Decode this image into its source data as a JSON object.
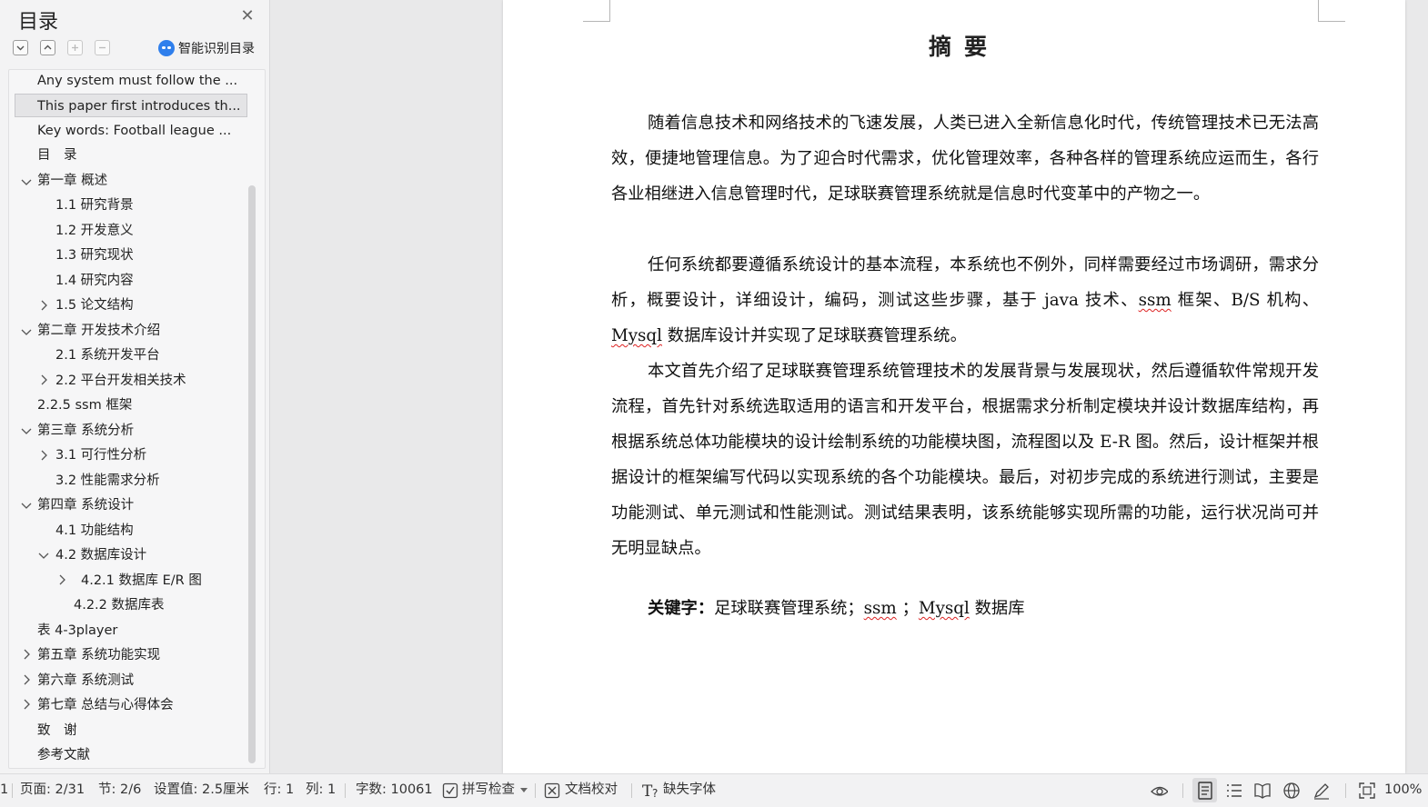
{
  "sidebar": {
    "title": "目录",
    "smart_label": "智能识别目录",
    "toc": [
      {
        "label": "Any system must follow the ..."
      },
      {
        "label": "This paper first introduces th..."
      },
      {
        "label": "Key words: Football league ..."
      },
      {
        "label": "目　录"
      },
      {
        "label": "第一章  概述"
      },
      {
        "label": "1.1  研究背景"
      },
      {
        "label": "1.2 开发意义"
      },
      {
        "label": "1.3  研究现状"
      },
      {
        "label": "1.4  研究内容"
      },
      {
        "label": "1.5 论文结构"
      },
      {
        "label": " 第二章  开发技术介绍"
      },
      {
        "label": "2.1  系统开发平台"
      },
      {
        "label": "2.2  平台开发相关技术"
      },
      {
        "label": "2.2.5    ssm 框架"
      },
      {
        "label": "第三章  系统分析"
      },
      {
        "label": "3.1  可行性分析"
      },
      {
        "label": "3.2 性能需求分析"
      },
      {
        "label": "第四章  系统设计"
      },
      {
        "label": "4.1 功能结构"
      },
      {
        "label": "4.2  数据库设计"
      },
      {
        "label": "4.2.1  数据库 E/R 图"
      },
      {
        "label": "4.2.2  数据库表"
      },
      {
        "label": "表 4-3player"
      },
      {
        "label": "第五章  系统功能实现"
      },
      {
        "label": "第六章  系统测试"
      },
      {
        "label": "第七章  总结与心得体会"
      },
      {
        "label": "致　谢"
      },
      {
        "label": "参考文献"
      }
    ]
  },
  "document": {
    "title": "摘要",
    "paragraphs": [
      "随着信息技术和网络技术的飞速发展，人类已进入全新信息化时代，传统管理技术已无法高效，便捷地管理信息。为了迎合时代需求，优化管理效率，各种各样的管理系统应运而生，各行各业相继进入信息管理时代，足球联赛管理系统就是信息时代变革中的产物之一。",
      "任何系统都要遵循系统设计的基本流程，本系统也不例外，同样需要经过市场调研，需求分析，概要设计，详细设计，编码，测试这些步骤，基于 java 技术、",
      "本文首先介绍了足球联赛管理系统管理技术的发展背景与发展现状，然后遵循软件常规开发流程，首先针对系统选取适用的语言和开发平台，根据需求分析制定模块并设计数据库结构，再根据系统总体功能模块的设计绘制系统的功能模块图，流程图以及 E-R 图。然后，设计框架并根据设计的框架编写代码以实现系统的各个功能模块。最后，对初步完成的系统进行测试，主要是功能测试、单元测试和性能测试。测试结果表明，该系统能够实现所需的功能，运行状况尚可并无明显缺点。"
    ],
    "p2_ssm": "ssm",
    "p2_mid": " 框架、B/S 机构、",
    "p2_mysql": "Mysql",
    "p2_tail": " 数据库设计并实现了足球联赛管理系统。",
    "keywords_label": "关键字：",
    "keywords_pre": "足球联赛管理系统；",
    "keywords_ssm": "ssm",
    "keywords_mid": " ；",
    "keywords_mysql": "Mysql",
    "keywords_tail": " 数据库"
  },
  "status": {
    "left_edge": "1",
    "page": "页面: 2/31",
    "section": "节: 2/6",
    "setting": "设置值: 2.5厘米",
    "row": "行: 1",
    "col": "列: 1",
    "words": "字数: 10061",
    "spellcheck": "拼写检查",
    "proofread": "文档校对",
    "missing_font": "缺失字体",
    "zoom": "100%"
  },
  "colors": {
    "accent": "#2f7fec",
    "spell_underline": "#d22"
  }
}
